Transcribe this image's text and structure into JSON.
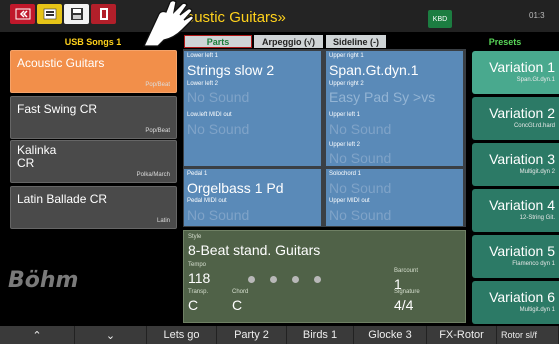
{
  "topbar": {
    "title": "«Acoustic Guitars»",
    "time": "01:3",
    "kb_label": "KBD"
  },
  "headers": {
    "usb_songs": "USB Songs 1",
    "parts": "Parts",
    "arpeggio": "Arpeggio (√)",
    "sideline": "Sideline (-)",
    "presets": "Presets"
  },
  "songs": [
    {
      "name": "Acoustic Guitars",
      "category": "Pop/Beat",
      "selected": true
    },
    {
      "name": "Fast Swing CR",
      "category": "Pop/Beat",
      "selected": false
    },
    {
      "name": "Kalinka\nCR",
      "category": "Polka/March",
      "selected": false
    },
    {
      "name": "Latin Ballade CR",
      "category": "Latin",
      "selected": false
    }
  ],
  "parts": {
    "lower_left_1_label": "Lower left 1",
    "lower_left_1_value": "Strings slow 2",
    "lower_left_2_label": "Lower left 2",
    "lower_left_2_value": "No Sound",
    "lower_left_midi_label": "Low.left MIDI out",
    "lower_left_midi_value": "No Sound",
    "upper_right_1_label": "Upper right 1",
    "upper_right_1_value": "Span.Gt.dyn.1",
    "upper_right_2_label": "Upper right 2",
    "upper_right_2_value": "Easy Pad Sy >vs",
    "upper_left_1_label": "Upper left 1",
    "upper_left_1_value": "No Sound",
    "upper_left_2_label": "Upper left 2",
    "upper_left_2_value": "No Sound",
    "pedal_1_label": "Pedal 1",
    "pedal_1_value": "Orgelbass 1  Pd",
    "pedal_midi_label": "Pedal MIDI out",
    "pedal_midi_value": "No Sound",
    "solochord_1_label": "Solochord 1",
    "solochord_1_value": "No Sound",
    "upper_midi_label": "Upper MIDI out",
    "upper_midi_value": "No Sound"
  },
  "style": {
    "style_label": "Style",
    "style_value": "8-Beat stand. Guitars",
    "tempo_label": "Tempo",
    "tempo_value": "118",
    "barcount_label": "Barcount",
    "barcount_value": "1",
    "transp_label": "Transp.",
    "transp_value": "C",
    "chord_label": "Chord",
    "chord_value": "C",
    "signature_label": "Signature",
    "signature_value": "4/4"
  },
  "presets": [
    {
      "name": "Variation 1",
      "sub": "Span.Gt.dyn.1",
      "selected": true
    },
    {
      "name": "Variation 2",
      "sub": "ConcGt.rd.hard",
      "selected": false
    },
    {
      "name": "Variation 3",
      "sub": "Multigit.dyn 2",
      "selected": false
    },
    {
      "name": "Variation 4",
      "sub": "12-String Git.",
      "selected": false
    },
    {
      "name": "Variation 5",
      "sub": "Flamenco dyn 1",
      "selected": false
    },
    {
      "name": "Variation 6",
      "sub": "Multigit.dyn 1",
      "selected": false
    }
  ],
  "bottombar": {
    "up": "⌃",
    "down": "⌄",
    "b1": "Lets go",
    "b2": "Party 2",
    "b3": "Birds 1",
    "b4": "Glocke 3",
    "b5": "FX-Rotor",
    "b6": "Rotor sl/f"
  },
  "brand": "Böhm",
  "colors": {
    "accent_yellow": "#ffd21c",
    "selected_song": "#f28f4a",
    "parts_blue": "#5a8ab8",
    "preset_green": "#2c7a66",
    "style_green": "#506248"
  },
  "icons": [
    "close-icon",
    "usb-icon",
    "disk-icon",
    "document-icon",
    "hand-pointer-icon",
    "keyboard-icon",
    "chevron-up-icon",
    "chevron-down-icon"
  ]
}
